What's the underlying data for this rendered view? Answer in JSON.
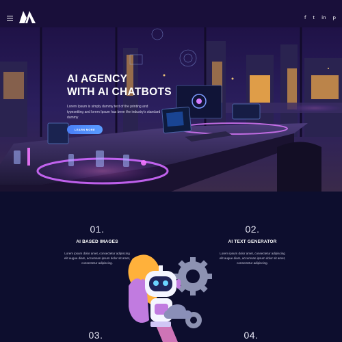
{
  "header": {
    "logo_icon": "agency-logo",
    "menu_icon": "hamburger-menu",
    "social": [
      {
        "name": "facebook",
        "glyph": "f"
      },
      {
        "name": "twitter",
        "glyph": "t"
      },
      {
        "name": "linkedin",
        "glyph": "in"
      },
      {
        "name": "pinterest",
        "glyph": "p"
      }
    ]
  },
  "hero": {
    "title_line1": "AI AGENCY",
    "title_line2": "WITH AI CHATBOTS",
    "text": "Lorem Ipsum is simply dummy text of the printing and typesetting and lorem Ipsum has been the industry's standard dummy",
    "cta_label": "LEARN MORE"
  },
  "features": [
    {
      "num": "01.",
      "title": "AI BASED IMAGES",
      "text": "Lorem ipsum dolor amet, consectetur adipiscing elit augue diam, accumsan ipsum dolor sit amet, consectetur adipiscing."
    },
    {
      "num": "02.",
      "title": "AI TEXT GENERATOR",
      "text": "Lorem ipsum dolor amet, consectetur adipiscing elit augue diam, accumsan ipsum dolor sit amet, consectetur adipiscing."
    },
    {
      "num": "03."
    },
    {
      "num": "04."
    }
  ],
  "colors": {
    "accent": "#4a7ff7",
    "background": "#0d0e2e",
    "neon": "#b84dff"
  }
}
